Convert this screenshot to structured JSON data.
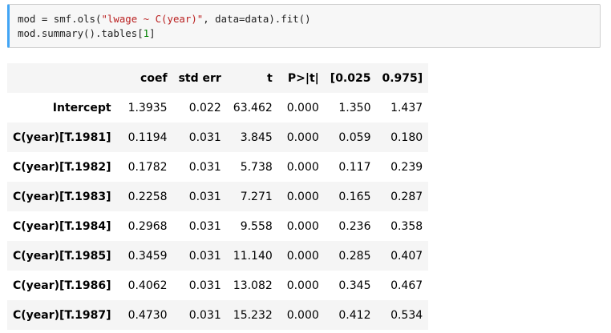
{
  "code_cell": {
    "line1": {
      "a": "mod = smf.ols(",
      "s": "\"lwage ~ C(year)\"",
      "b": ", data=data).fit()"
    },
    "line2": {
      "a": "mod.summary().tables[",
      "n": "1",
      "b": "]"
    }
  },
  "summary_table": {
    "columns": [
      "",
      "coef",
      "std err",
      "t",
      "P>|t|",
      "[0.025",
      "0.975]"
    ],
    "rows": [
      {
        "label": "Intercept",
        "values": [
          "1.3935",
          "0.022",
          "63.462",
          "0.000",
          "1.350",
          "1.437"
        ]
      },
      {
        "label": "C(year)[T.1981]",
        "values": [
          "0.1194",
          "0.031",
          "3.845",
          "0.000",
          "0.059",
          "0.180"
        ]
      },
      {
        "label": "C(year)[T.1982]",
        "values": [
          "0.1782",
          "0.031",
          "5.738",
          "0.000",
          "0.117",
          "0.239"
        ]
      },
      {
        "label": "C(year)[T.1983]",
        "values": [
          "0.2258",
          "0.031",
          "7.271",
          "0.000",
          "0.165",
          "0.287"
        ]
      },
      {
        "label": "C(year)[T.1984]",
        "values": [
          "0.2968",
          "0.031",
          "9.558",
          "0.000",
          "0.236",
          "0.358"
        ]
      },
      {
        "label": "C(year)[T.1985]",
        "values": [
          "0.3459",
          "0.031",
          "11.140",
          "0.000",
          "0.285",
          "0.407"
        ]
      },
      {
        "label": "C(year)[T.1986]",
        "values": [
          "0.4062",
          "0.031",
          "13.082",
          "0.000",
          "0.345",
          "0.467"
        ]
      },
      {
        "label": "C(year)[T.1987]",
        "values": [
          "0.4730",
          "0.031",
          "15.232",
          "0.000",
          "0.412",
          "0.534"
        ]
      }
    ]
  }
}
